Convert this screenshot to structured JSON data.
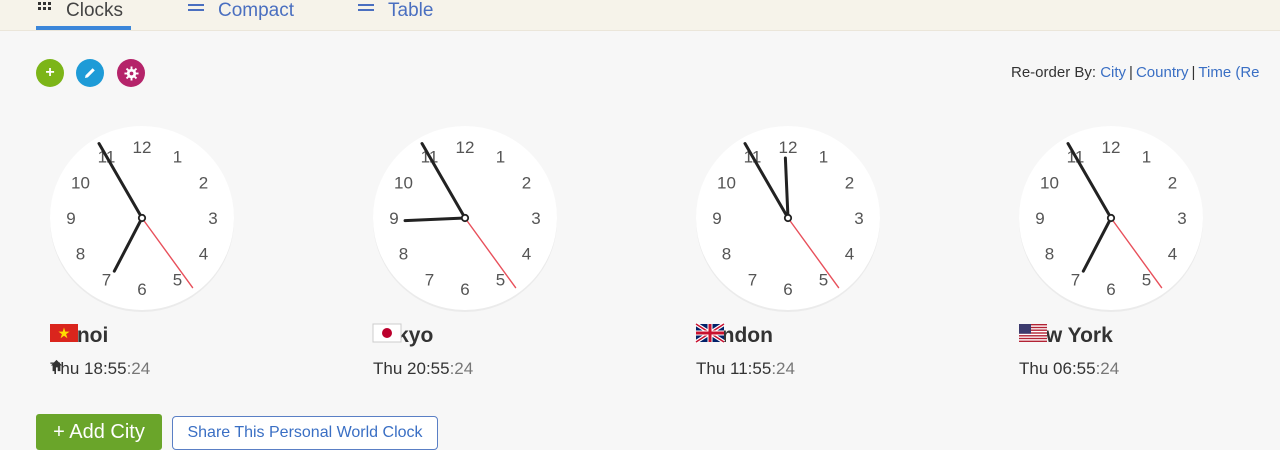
{
  "tabs": [
    {
      "label": "Clocks",
      "icon": "grid-icon"
    },
    {
      "label": "Compact",
      "icon": "list-icon"
    },
    {
      "label": "Table",
      "icon": "list-icon"
    }
  ],
  "toolbar": {
    "add_icon": "+",
    "colors": {
      "add": "#7cb518",
      "edit": "#1e9bd7",
      "settings": "#b5246a"
    }
  },
  "reorder": {
    "label": "Re-order By:",
    "options": [
      "City",
      "Country",
      "Time (Re"
    ]
  },
  "clocks": [
    {
      "city": "Hanoi",
      "flag": "vietnam-flag",
      "day": "Thu",
      "time": "18:55",
      "seconds": ":24",
      "hour": 18,
      "minute": 55,
      "second": 24,
      "home": true
    },
    {
      "city": "Tokyo",
      "flag": "japan-flag",
      "day": "Thu",
      "time": "20:55",
      "seconds": ":24",
      "hour": 20,
      "minute": 55,
      "second": 24,
      "home": false
    },
    {
      "city": "London",
      "flag": "uk-flag",
      "day": "Thu",
      "time": "11:55",
      "seconds": ":24",
      "hour": 11,
      "minute": 55,
      "second": 24,
      "home": false
    },
    {
      "city": "New York",
      "flag": "us-flag",
      "day": "Thu",
      "time": "06:55",
      "seconds": ":24",
      "hour": 6,
      "minute": 55,
      "second": 24,
      "home": false
    }
  ],
  "dial_numbers": [
    "12",
    "1",
    "2",
    "3",
    "4",
    "5",
    "6",
    "7",
    "8",
    "9",
    "10",
    "11"
  ],
  "actions": {
    "add_city": "+ Add City",
    "share": "Share This Personal World Clock"
  },
  "colors": {
    "accent": "#3b86d9",
    "link": "#3a6fc4",
    "second_hand": "#e8505b",
    "add_city_bg": "#6aa52a"
  }
}
